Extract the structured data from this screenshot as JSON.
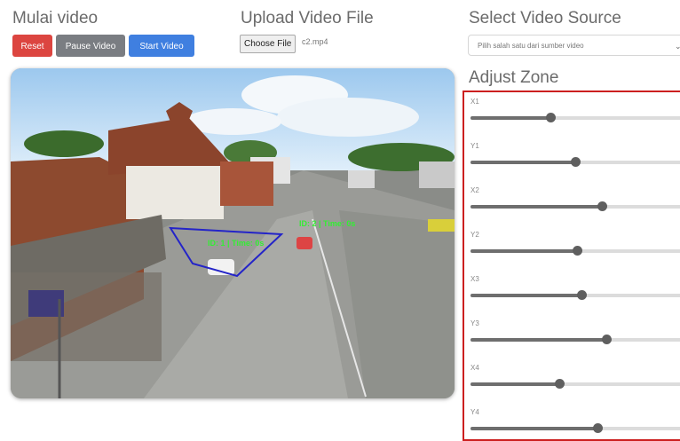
{
  "headings": {
    "mulai": "Mulai video",
    "upload": "Upload Video File",
    "select": "Select Video Source",
    "adjust": "Adjust Zone"
  },
  "buttons": {
    "reset": "Reset",
    "pause": "Pause Video",
    "start": "Start Video"
  },
  "upload": {
    "choose_label": "Choose File",
    "filename": "c2.mp4"
  },
  "source": {
    "selected": "Pilih salah satu dari sumber video"
  },
  "video": {
    "overlay_text_1": "ID: 1 | Time: 0s",
    "overlay_text_2": "ID: 2 | Time: 0s"
  },
  "colors": {
    "reset": "#dc4540",
    "pause": "#7a7d82",
    "start": "#3f7fe0",
    "zone_border": "#cc1f1f",
    "overlay_polygon": "#2424c8",
    "overlay_text": "#33ee33"
  },
  "sliders": [
    {
      "label": "X1",
      "value": 0.36
    },
    {
      "label": "Y1",
      "value": 0.47
    },
    {
      "label": "X2",
      "value": 0.59
    },
    {
      "label": "Y2",
      "value": 0.48
    },
    {
      "label": "X3",
      "value": 0.5
    },
    {
      "label": "Y3",
      "value": 0.61
    },
    {
      "label": "X4",
      "value": 0.4
    },
    {
      "label": "Y4",
      "value": 0.57
    }
  ]
}
